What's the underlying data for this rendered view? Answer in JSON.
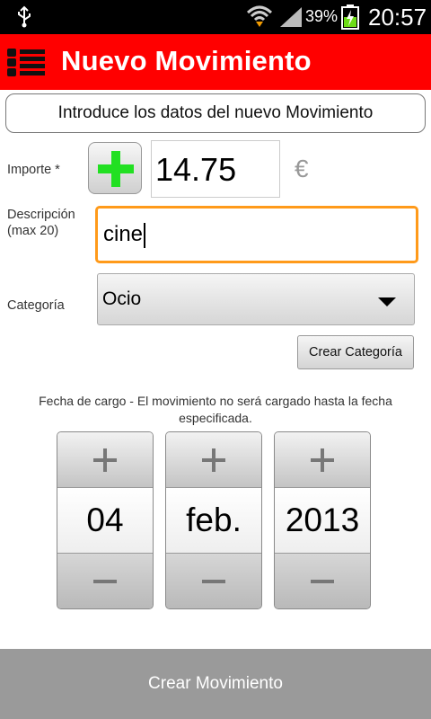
{
  "status_bar": {
    "battery_percent": "39%",
    "time": "20:57",
    "icons": [
      "usb-icon",
      "wifi-icon",
      "signal-icon",
      "battery-charging-icon"
    ]
  },
  "action_bar": {
    "title": "Nuevo Movimiento",
    "icon": "menu-list-icon",
    "color": "#ff0000"
  },
  "form": {
    "intro": "Introduce los datos del nuevo Movimiento",
    "importe_label": "Importe *",
    "importe_value": "14.75",
    "currency": "€",
    "descripcion_label_line1": "Descripción",
    "descripcion_label_line2": "(max 20)",
    "descripcion_value": "cine",
    "categoria_label": "Categoría",
    "categoria_value": "Ocio",
    "crear_categoria": "Crear Categoría",
    "fecha_note": "Fecha de cargo - El movimiento no será cargado hasta la fecha especificada."
  },
  "date": {
    "day": "04",
    "month": "feb.",
    "year": "2013"
  },
  "footer": {
    "crear_movimiento": "Crear Movimiento"
  }
}
